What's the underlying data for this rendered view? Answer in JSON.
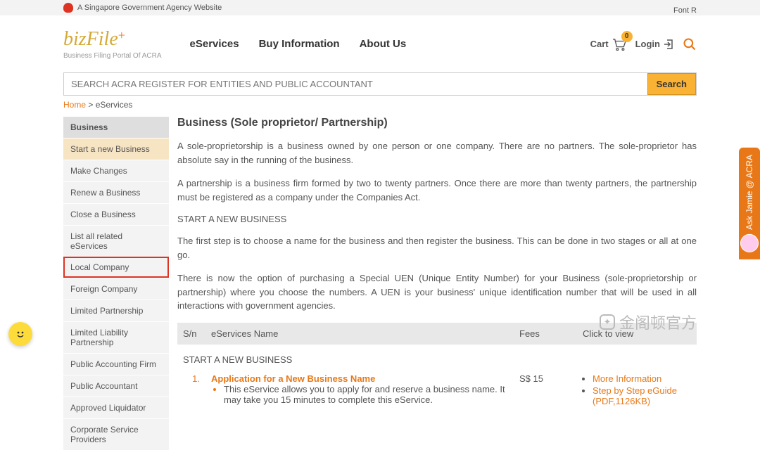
{
  "govbar": {
    "text": "A Singapore Government Agency Website"
  },
  "fontres": {
    "label": "Font R"
  },
  "logo": {
    "brand": "bizFile",
    "plus": "+",
    "sub": "Business Filing Portal Of ACRA"
  },
  "nav": {
    "eservices": "eServices",
    "buyinfo": "Buy Information",
    "about": "About Us"
  },
  "cart": {
    "label": "Cart",
    "count": "0"
  },
  "login": {
    "label": "Login"
  },
  "search": {
    "placeholder": "SEARCH ACRA REGISTER FOR ENTITIES AND PUBLIC ACCOUNTANT",
    "button": "Search"
  },
  "breadcrumb": {
    "home": "Home",
    "sep": " > ",
    "current": "eServices"
  },
  "sidebar": {
    "head": "Business",
    "items": [
      {
        "label": "Start a new Business",
        "active": true
      },
      {
        "label": "Make Changes"
      },
      {
        "label": "Renew a Business"
      },
      {
        "label": "Close a Business"
      },
      {
        "label": "List all related eServices"
      },
      {
        "label": "Local Company",
        "highlighted": true
      },
      {
        "label": "Foreign Company"
      },
      {
        "label": "Limited Partnership"
      },
      {
        "label": "Limited Liability Partnership"
      },
      {
        "label": "Public Accounting Firm"
      },
      {
        "label": "Public Accountant"
      },
      {
        "label": "Approved Liquidator"
      },
      {
        "label": "Corporate Service Providers"
      }
    ]
  },
  "content": {
    "title": "Business (Sole proprietor/ Partnership)",
    "p1": "A sole-proprietorship is a business owned by one person or one company. There are no partners. The sole-proprietor has absolute say in the running of the business.",
    "p2": "A partnership is a business firm formed by two to twenty partners. Once there are more than twenty partners, the partnership must be registered as a company under the Companies Act.",
    "h1": "START A NEW BUSINESS",
    "p3": "The first step is to choose a name for the business and then register the business. This can be done in two stages or all at one go.",
    "p4": "There is now the option of purchasing a Special UEN (Unique Entity Number) for your Business (sole-proprietorship or partnership) where you choose the numbers. A UEN is your business' unique identification number that will be used in all interactions with government agencies.",
    "table": {
      "cols": {
        "sn": "S/n",
        "name": "eServices Name",
        "fees": "Fees",
        "click": "Click to view"
      },
      "section": "START A NEW BUSINESS",
      "row1": {
        "num": "1.",
        "title": "Application for a New Business Name",
        "desc": "This eService allows you to apply for and reserve a business name. It may take you 15 minutes to complete this eService.",
        "fee": "S$ 15",
        "links": {
          "more": "More Information",
          "guide": "Step by Step eGuide (PDF,1126KB)"
        }
      }
    }
  },
  "askjamie": {
    "label": "Ask Jamie @ ACRA"
  },
  "watermark": {
    "text": "金阁顿官方"
  }
}
